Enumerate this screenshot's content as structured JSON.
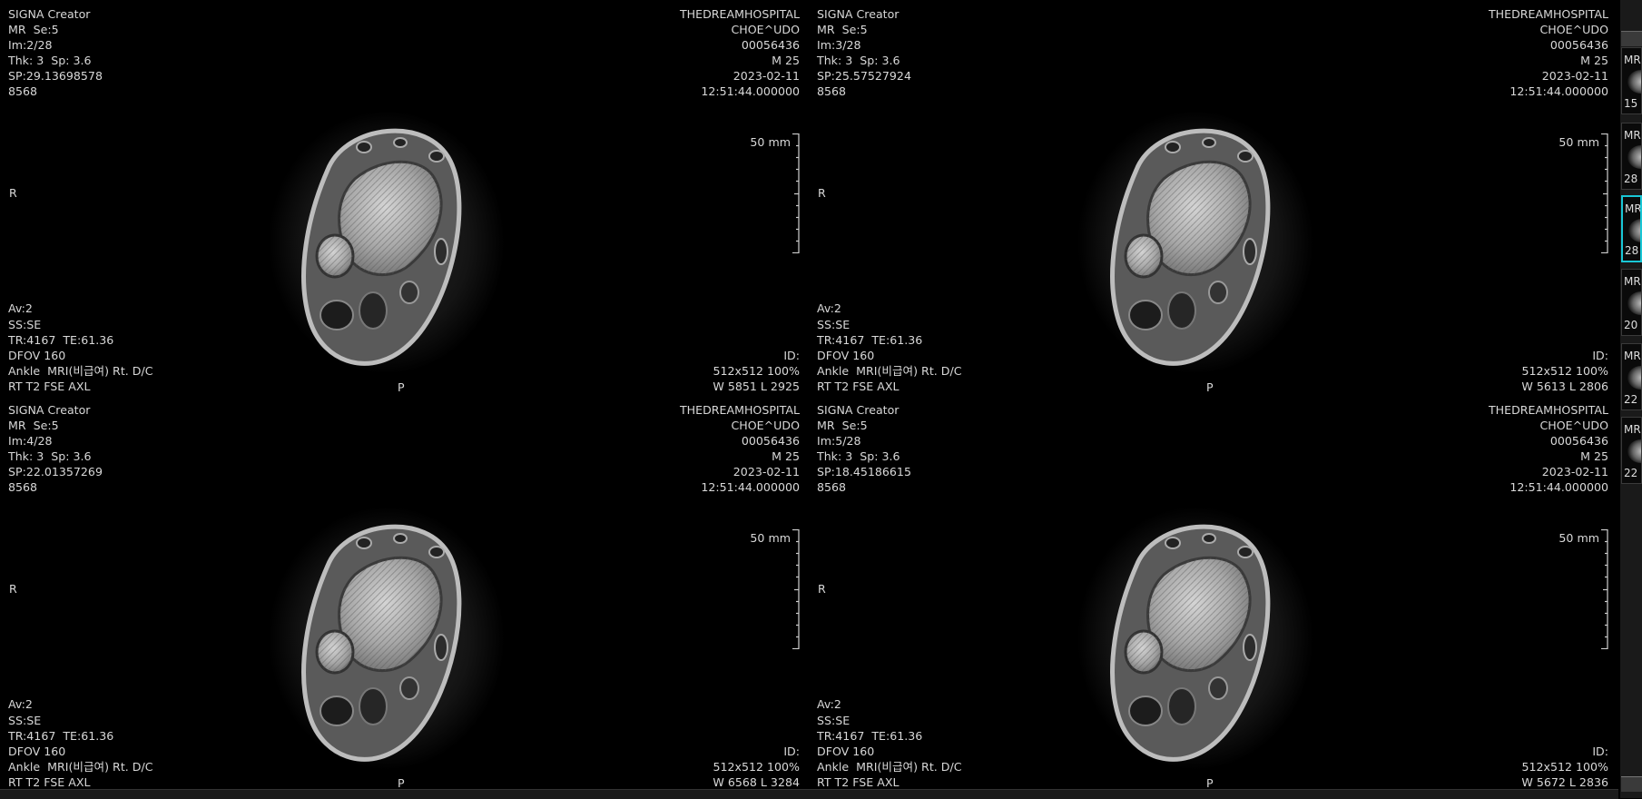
{
  "viewports": [
    {
      "top_left": [
        "SIGNA Creator",
        "MR  Se:5",
        "Im:2/28",
        "Thk: 3  Sp: 3.6",
        "SP:29.13698578",
        "8568"
      ],
      "top_right": [
        "THEDREAMHOSPITAL",
        "CHOE^UDO",
        "00056436",
        "M 25",
        "2023-02-11",
        "12:51:44.000000"
      ],
      "bottom_left": [
        "Av:2",
        "SS:SE",
        "TR:4167  TE:61.36",
        "DFOV 160",
        "Ankle  MRI(비급여) Rt. D/C",
        "RT T2 FSE AXL"
      ],
      "bottom_right": [
        "ID:",
        "512x512 100%",
        "W 5851 L 2925"
      ],
      "orientation_left": "R",
      "orientation_bottom": "P",
      "scale_label": "50 mm"
    },
    {
      "top_left": [
        "SIGNA Creator",
        "MR  Se:5",
        "Im:3/28",
        "Thk: 3  Sp: 3.6",
        "SP:25.57527924",
        "8568"
      ],
      "top_right": [
        "THEDREAMHOSPITAL",
        "CHOE^UDO",
        "00056436",
        "M 25",
        "2023-02-11",
        "12:51:44.000000"
      ],
      "bottom_left": [
        "Av:2",
        "SS:SE",
        "TR:4167  TE:61.36",
        "DFOV 160",
        "Ankle  MRI(비급여) Rt. D/C",
        "RT T2 FSE AXL"
      ],
      "bottom_right": [
        "ID:",
        "512x512 100%",
        "W 5613 L 2806"
      ],
      "orientation_left": "R",
      "orientation_bottom": "P",
      "scale_label": "50 mm"
    },
    {
      "top_left": [
        "SIGNA Creator",
        "MR  Se:5",
        "Im:4/28",
        "Thk: 3  Sp: 3.6",
        "SP:22.01357269",
        "8568"
      ],
      "top_right": [
        "THEDREAMHOSPITAL",
        "CHOE^UDO",
        "00056436",
        "M 25",
        "2023-02-11",
        "12:51:44.000000"
      ],
      "bottom_left": [
        "Av:2",
        "SS:SE",
        "TR:4167  TE:61.36",
        "DFOV 160",
        "Ankle  MRI(비급여) Rt. D/C",
        "RT T2 FSE AXL"
      ],
      "bottom_right": [
        "ID:",
        "512x512 100%",
        "W 6568 L 3284"
      ],
      "orientation_left": "R",
      "orientation_bottom": "P",
      "scale_label": "50 mm"
    },
    {
      "top_left": [
        "SIGNA Creator",
        "MR  Se:5",
        "Im:5/28",
        "Thk: 3  Sp: 3.6",
        "SP:18.45186615",
        "8568"
      ],
      "top_right": [
        "THEDREAMHOSPITAL",
        "CHOE^UDO",
        "00056436",
        "M 25",
        "2023-02-11",
        "12:51:44.000000"
      ],
      "bottom_left": [
        "Av:2",
        "SS:SE",
        "TR:4167  TE:61.36",
        "DFOV 160",
        "Ankle  MRI(비급여) Rt. D/C",
        "RT T2 FSE AXL"
      ],
      "bottom_right": [
        "ID:",
        "512x512 100%",
        "W 5672 L 2836"
      ],
      "orientation_left": "R",
      "orientation_bottom": "P",
      "scale_label": "50 mm"
    }
  ],
  "thumbnails": [
    {
      "modality": "MR",
      "count": "15",
      "selected": false
    },
    {
      "modality": "MR",
      "count": "28",
      "selected": false
    },
    {
      "modality": "MR",
      "count": "28",
      "selected": true
    },
    {
      "modality": "MR",
      "count": "20",
      "selected": false
    },
    {
      "modality": "MR",
      "count": "22",
      "selected": false
    },
    {
      "modality": "MR",
      "count": "22",
      "selected": false
    }
  ],
  "colors": {
    "background": "#000000",
    "overlay_text": "#d8d8d8",
    "selection": "#19c7d6"
  }
}
